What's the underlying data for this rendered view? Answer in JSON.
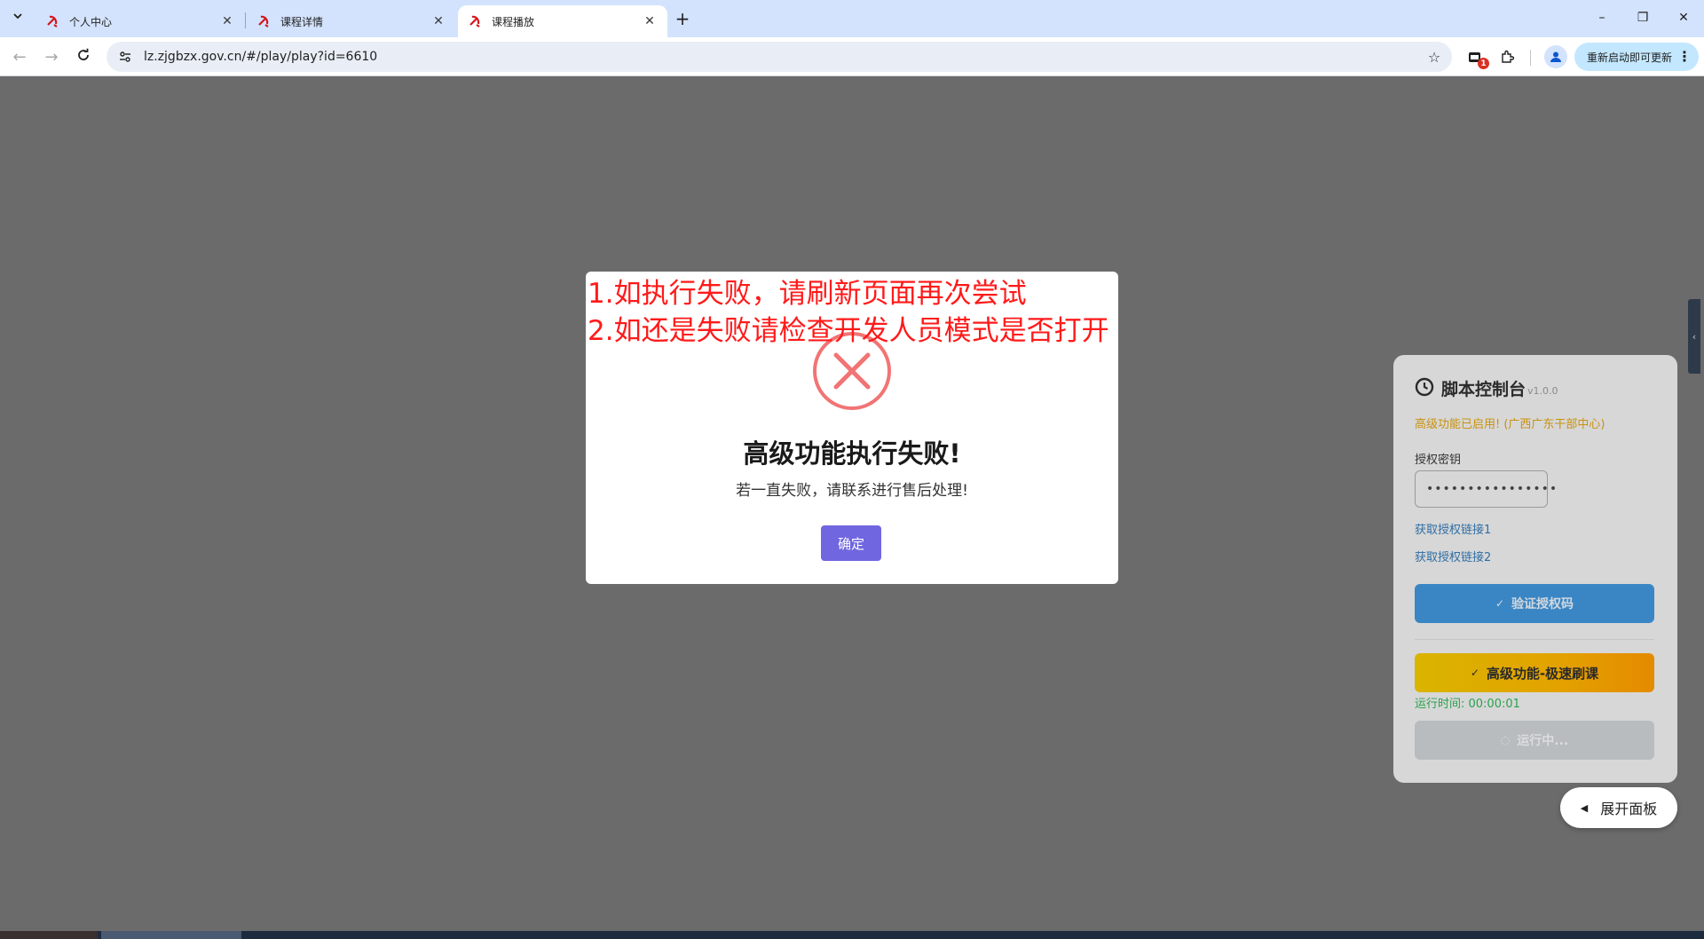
{
  "browser": {
    "tabs": [
      {
        "label": "个人中心",
        "active": false
      },
      {
        "label": "课程详情",
        "active": false
      },
      {
        "label": "课程播放",
        "active": true
      }
    ],
    "new_tab": "+",
    "url": "lz.zjgbzx.gov.cn/#/play/play?id=6610",
    "extension_badge": "1",
    "update_button": "重新启动即可更新",
    "window_controls": {
      "minimize": "–",
      "restore": "❐",
      "close": "✕"
    }
  },
  "dialog": {
    "title": "高级功能执行失败!",
    "message": "若一直失败，请联系进行售后处理!",
    "confirm_label": "确定",
    "accent_color": "#7066e0",
    "icon": "error-x-icon"
  },
  "overlay_note": {
    "line1": "1.如执行失败，请刷新页面再次尝试",
    "line2": "2.如还是失败请检查开发人员模式是否打开",
    "color": "#ff1a1a"
  },
  "panel": {
    "title": "脚本控制台",
    "version": "v1.0.0",
    "status": "高级功能已启用! (广西广东干部中心)",
    "auth_label": "授权密钥",
    "auth_value": "••••••••••••••••",
    "link1": "获取授权链接1",
    "link2": "获取授权链接2",
    "verify_button": "验证授权码",
    "turbo_button": "高级功能-极速刷课",
    "runtime": "运行时间: 00:00:01",
    "running_button": "运行中..."
  },
  "expand_button": "展开面板"
}
